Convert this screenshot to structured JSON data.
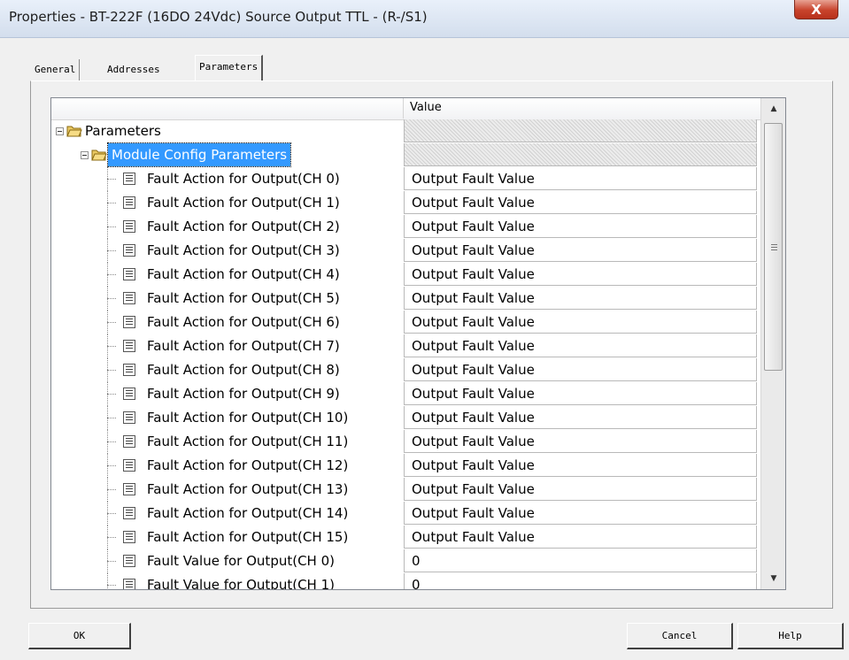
{
  "window": {
    "title": "Properties - BT-222F (16DO 24Vdc) Source Output TTL - (R-/S1)",
    "close_glyph": "X"
  },
  "tabs": [
    {
      "label": "General"
    },
    {
      "label": "Addresses"
    },
    {
      "label": "Parameters",
      "active": true
    }
  ],
  "grid": {
    "value_header": "Value",
    "rows": [
      {
        "label": "Parameters",
        "value": ""
      },
      {
        "label": "Module Config Parameters",
        "value": ""
      },
      {
        "label": "Fault Action for Output(CH 0)",
        "value": "Output Fault Value"
      },
      {
        "label": "Fault Action for Output(CH 1)",
        "value": "Output Fault Value"
      },
      {
        "label": "Fault Action for Output(CH 2)",
        "value": "Output Fault Value"
      },
      {
        "label": "Fault Action for Output(CH 3)",
        "value": "Output Fault Value"
      },
      {
        "label": "Fault Action for Output(CH 4)",
        "value": "Output Fault Value"
      },
      {
        "label": "Fault Action for Output(CH 5)",
        "value": "Output Fault Value"
      },
      {
        "label": "Fault Action for Output(CH 6)",
        "value": "Output Fault Value"
      },
      {
        "label": "Fault Action for Output(CH 7)",
        "value": "Output Fault Value"
      },
      {
        "label": "Fault Action for Output(CH 8)",
        "value": "Output Fault Value"
      },
      {
        "label": "Fault Action for Output(CH 9)",
        "value": "Output Fault Value"
      },
      {
        "label": "Fault Action for Output(CH 10)",
        "value": "Output Fault Value"
      },
      {
        "label": "Fault Action for Output(CH 11)",
        "value": "Output Fault Value"
      },
      {
        "label": "Fault Action for Output(CH 12)",
        "value": "Output Fault Value"
      },
      {
        "label": "Fault Action for Output(CH 13)",
        "value": "Output Fault Value"
      },
      {
        "label": "Fault Action for Output(CH 14)",
        "value": "Output Fault Value"
      },
      {
        "label": "Fault Action for Output(CH 15)",
        "value": "Output Fault Value"
      },
      {
        "label": "Fault Value for Output(CH 0)",
        "value": "0"
      },
      {
        "label": "Fault Value for Output(CH 1)",
        "value": "0"
      }
    ]
  },
  "buttons": {
    "ok": "OK",
    "cancel": "Cancel",
    "help": "Help"
  },
  "icons": {
    "folder": "folder-icon",
    "parameter": "parameter-doc-icon",
    "expander": "collapse-minus-icon",
    "scroll_up": "scroll-up-arrow-icon",
    "scroll_down": "scroll-down-arrow-icon"
  },
  "colors": {
    "selection": "#3399ff",
    "close_button": "#c8432c"
  }
}
